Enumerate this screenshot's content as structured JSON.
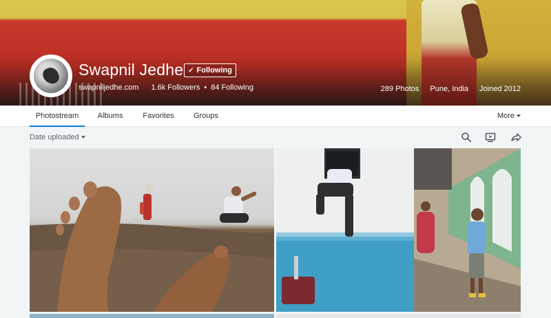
{
  "profile": {
    "name": "Swapnil Jedhe",
    "follow_label": "Following",
    "website": "swapniljedhe.com",
    "followers": "1.6k Followers",
    "following": "84 Following",
    "photos": "289 Photos",
    "location": "Pune, India",
    "joined": "Joined 2012"
  },
  "nav": {
    "tabs": [
      {
        "label": "Photostream",
        "active": true
      },
      {
        "label": "Albums",
        "active": false
      },
      {
        "label": "Favorites",
        "active": false
      },
      {
        "label": "Groups",
        "active": false
      }
    ],
    "more_label": "More"
  },
  "toolbar": {
    "sort_label": "Date uploaded",
    "icons": [
      "search-icon",
      "slideshow-icon",
      "share-icon"
    ]
  },
  "colors": {
    "accent": "#0a7bd3",
    "cover_red": "#bd2f24",
    "cover_yellow": "#d8c04a"
  }
}
